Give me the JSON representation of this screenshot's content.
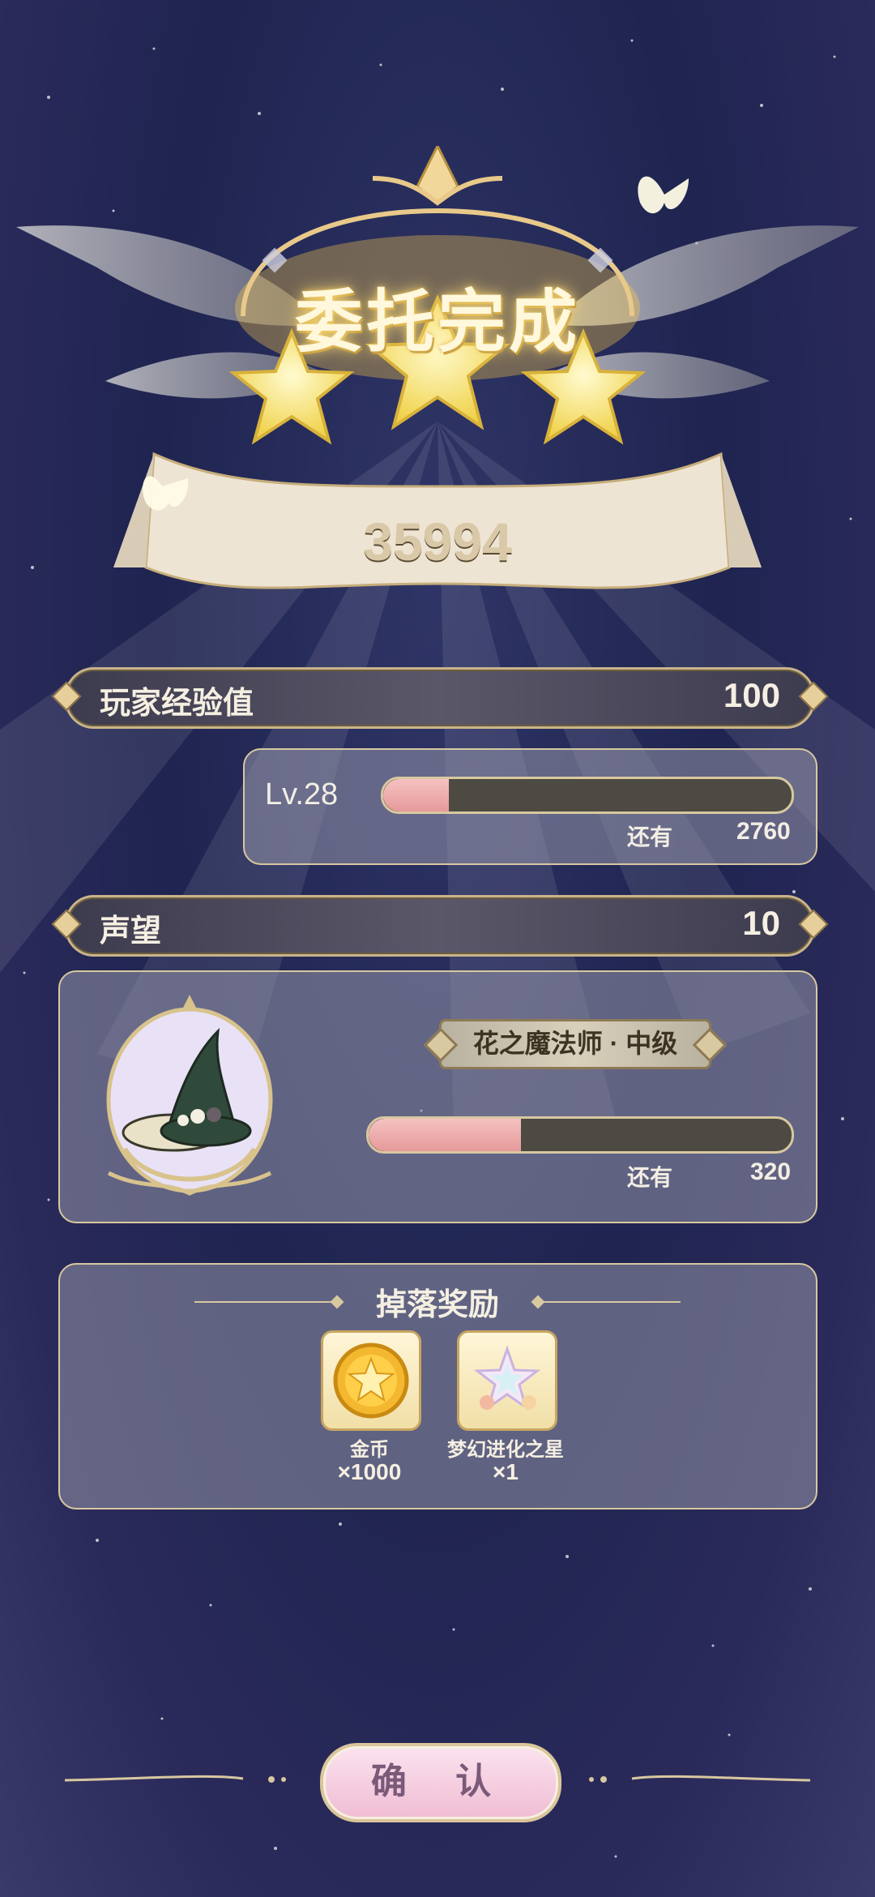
{
  "header": {
    "title": "委托完成",
    "score": "35994"
  },
  "player_exp": {
    "label": "玩家经验值",
    "value": "100",
    "level": "Lv.28",
    "progress": 0.16,
    "remain_label": "还有",
    "remain_value": "2760"
  },
  "reputation": {
    "label": "声望",
    "value": "10",
    "title": "花之魔法师 · 中级",
    "progress": 0.36,
    "remain_label": "还有",
    "remain_value": "320"
  },
  "rewards": {
    "title": "掉落奖励",
    "items": [
      {
        "name": "金币",
        "count": "×1000",
        "icon": "gold-coin-icon"
      },
      {
        "name": "梦幻进化之星",
        "count": "×1",
        "icon": "dream-evolution-star-icon"
      }
    ]
  },
  "confirm_label": "确 认",
  "colors": {
    "background": "#2a2d5e",
    "gold": "#d9c59a",
    "progress_fill": "#f0b0b0",
    "progress_track": "#4c4a42"
  }
}
